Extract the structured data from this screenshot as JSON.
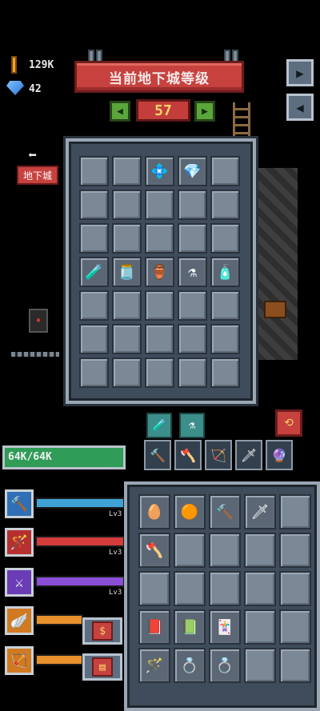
{
  "resources": {
    "gold": "129K",
    "gems": "42",
    "gold_icon": "gold-bar-icon",
    "gem_icon": "diamond-icon"
  },
  "header": {
    "title": "当前地下城等级",
    "level": "57",
    "prev_icon": "◀",
    "next_icon": "▶"
  },
  "side": {
    "exit_icon": "exit-door-icon",
    "sound_icon": "speaker-icon"
  },
  "nav": {
    "back_arrow": "⬅",
    "dungeon_label": "地下城"
  },
  "inventory": {
    "rows": [
      [
        "",
        "",
        "💠",
        "💎",
        ""
      ],
      [
        "",
        "",
        "",
        "",
        ""
      ],
      [
        "",
        "",
        "",
        "",
        ""
      ],
      [
        "🧪",
        "🫙",
        "🏺",
        "⚗",
        "🧴"
      ],
      [
        "",
        "",
        "",
        "",
        ""
      ],
      [
        "",
        "",
        "",
        "",
        ""
      ],
      [
        "",
        "",
        "",
        "",
        ""
      ]
    ]
  },
  "player": {
    "hp_text": "64K/64K"
  },
  "skills": [
    {
      "name": "mace-skill",
      "icon": "🔨",
      "color": "#3fa3d6",
      "bg": "#2f6fb5",
      "level": "Lv3"
    },
    {
      "name": "fire-wand-skill",
      "icon": "🪄",
      "color": "#d43b3b",
      "bg": "#b5302f",
      "level": "Lv3"
    },
    {
      "name": "arcane-skill",
      "icon": "⚔",
      "color": "#8a4fd6",
      "bg": "#6a3cb5",
      "level": "Lv3"
    },
    {
      "name": "wings-skill",
      "icon": "🪽",
      "color": "#e8902e",
      "bg": "#d07a22",
      "level": ""
    },
    {
      "name": "bow-skill",
      "icon": "🏹",
      "color": "#e8902e",
      "bg": "#d07a22",
      "level": ""
    }
  ],
  "shop": {
    "buy_icon": "$",
    "chest_icon": "▤"
  },
  "potions": [
    "🧪",
    "⚗"
  ],
  "equipped": [
    "🔨",
    "🪓",
    "🏹",
    "🗡",
    "🔮"
  ],
  "equipment_grid": {
    "rows": [
      [
        "🥚",
        "🟠",
        "🔨",
        "🗡",
        ""
      ],
      [
        "🪓",
        "",
        "",
        "",
        ""
      ],
      [
        "",
        "",
        "",
        "",
        ""
      ],
      [
        "📕",
        "📗",
        "🃏",
        "",
        ""
      ],
      [
        "🪄",
        "💍",
        "💍",
        "",
        ""
      ]
    ]
  }
}
